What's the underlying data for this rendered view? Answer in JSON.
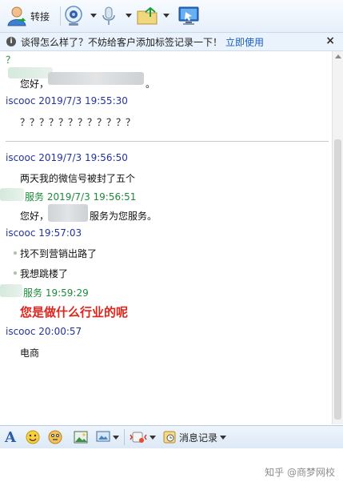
{
  "toolbar": {
    "transfer_label": "转接"
  },
  "notice": {
    "text": "谈得怎么样了？不妨给客户添加标签记录一下！",
    "link": "立即使用",
    "close": "×"
  },
  "chat": {
    "partial_first": "？",
    "partial_text": "您好，",
    "partial_end": "。",
    "messages": [
      {
        "head": "iscooc 2019/7/3 19:55:30",
        "body": "？？？？？？？？？？？？"
      },
      {
        "head": "iscooc 2019/7/3 19:56:50",
        "body": "两天我的微信号被封了五个"
      },
      {
        "head": "服务 2019/7/3 19:56:51",
        "body_pre": "您好，",
        "body_post": "服务为您服务。"
      },
      {
        "head": "iscooc  19:57:03",
        "body1": "找不到营销出路了",
        "body2": "我想跳楼了"
      },
      {
        "head": "服务   19:59:29",
        "body": "您是做什么行业的呢"
      },
      {
        "head": "iscooc  20:00:57",
        "body": "电商"
      }
    ]
  },
  "bottom_toolbar": {
    "history_label": "消息记录"
  },
  "watermark": "知乎 @商梦网校"
}
